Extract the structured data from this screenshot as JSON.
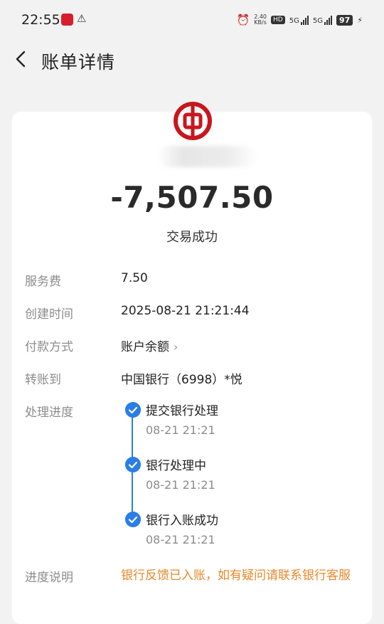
{
  "status_bar": {
    "time": "22:55",
    "speed_value": "2.40",
    "speed_unit": "KB/s",
    "hd_label": "HD",
    "signal1_label": "5G",
    "signal2_label": "5G",
    "battery": "97"
  },
  "header": {
    "title": "账单详情",
    "back_icon": "chevron-left-icon"
  },
  "summary": {
    "bank_logo": "bank-of-china-logo",
    "amount": "-7,507.50",
    "status": "交易成功"
  },
  "details": {
    "fee_label": "服务费",
    "fee_value": "7.50",
    "created_label": "创建时间",
    "created_value": "2025-08-21 21:21:44",
    "payment_label": "付款方式",
    "payment_value": "账户余额",
    "transfer_label": "转账到",
    "transfer_value": "中国银行（6998）*悦",
    "progress_label": "处理进度"
  },
  "progress_steps": [
    {
      "title": "提交银行处理",
      "time": "08-21 21:21"
    },
    {
      "title": "银行处理中",
      "time": "08-21 21:21"
    },
    {
      "title": "银行入账成功",
      "time": "08-21 21:21"
    }
  ],
  "note": {
    "label": "进度说明",
    "text": "银行反馈已入账，如有疑问请联系银行客服"
  },
  "colors": {
    "accent_blue": "#2a7ee6",
    "note_orange": "#e8892a",
    "bank_red": "#c8161d"
  }
}
